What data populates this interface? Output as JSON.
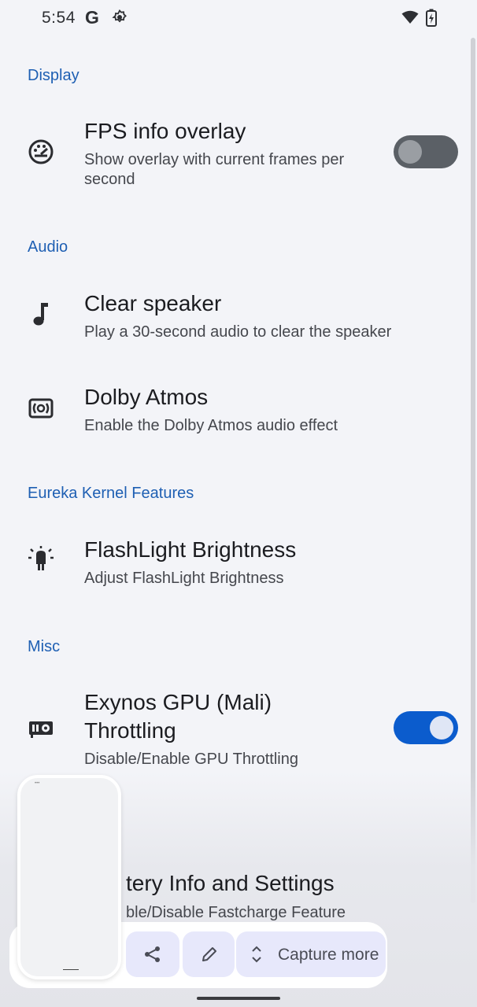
{
  "status_bar": {
    "time": "5:54",
    "google_icon": "G",
    "icons": [
      "gear-icon",
      "wifi-icon",
      "battery-charging-icon"
    ]
  },
  "sections": [
    {
      "header": "Display",
      "items": [
        {
          "icon": "speedometer-icon",
          "title": "FPS info overlay",
          "summary_lines": [
            "Show overlay with current frames per",
            "second"
          ],
          "switch": "off"
        }
      ]
    },
    {
      "header": "Audio",
      "items": [
        {
          "icon": "music-note-icon",
          "title": "Clear speaker",
          "summary": "Play a 30-second audio to clear the speaker"
        },
        {
          "icon": "surround-sound-icon",
          "title": "Dolby Atmos",
          "summary": "Enable the Dolby Atmos audio effect"
        }
      ]
    },
    {
      "header": "Eureka Kernel Features",
      "items": [
        {
          "icon": "flashlight-icon",
          "title": "FlashLight Brightness",
          "summary": "Adjust FlashLight Brightness"
        }
      ]
    },
    {
      "header": "Misc",
      "items": [
        {
          "icon": "gpu-icon",
          "title_lines": [
            "Exynos GPU (Mali)",
            "Throttling"
          ],
          "summary": "Disable/Enable GPU Throttling",
          "switch": "on"
        },
        {
          "title_partial": "tery Info and Settings",
          "summary_partial": "ble/Disable Fastcharge Feature"
        }
      ]
    }
  ],
  "capture_toolbar": {
    "share_icon": "share-icon",
    "edit_icon": "pencil-icon",
    "expand_icon": "chevron-up-down-icon",
    "capture_more_label": "Capture more"
  },
  "colors": {
    "background": "#f3f4f8",
    "accent": "#1e5fb3",
    "switch_on": "#0b5ccd",
    "switch_off": "#5b6066"
  }
}
